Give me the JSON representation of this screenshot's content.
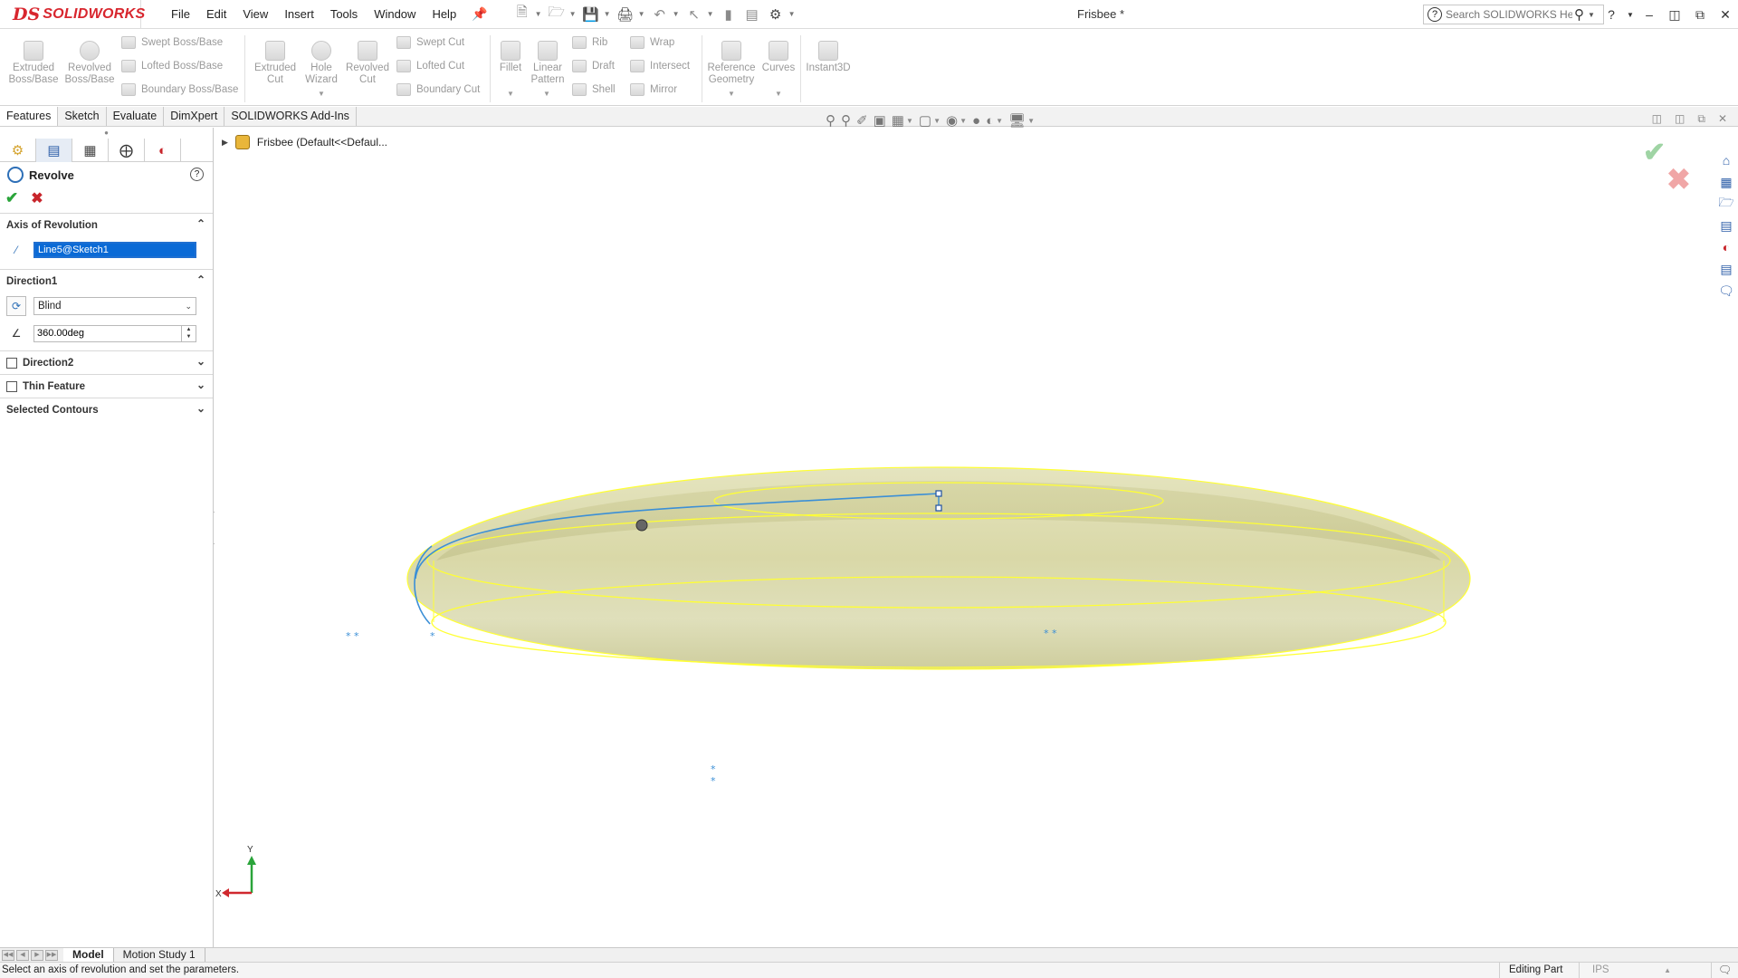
{
  "app": {
    "logo_prefix": "DS",
    "logo_text": "SOLIDWORKS",
    "document_title": "Frisbee *"
  },
  "menu": [
    "File",
    "Edit",
    "View",
    "Insert",
    "Tools",
    "Window",
    "Help"
  ],
  "search": {
    "placeholder": "Search SOLIDWORKS Help"
  },
  "command_manager": {
    "extruded_boss": "Extruded Boss/Base",
    "revolved_boss": "Revolved Boss/Base",
    "swept_boss": "Swept Boss/Base",
    "lofted_boss": "Lofted Boss/Base",
    "boundary_boss": "Boundary Boss/Base",
    "extruded_cut": "Extruded Cut",
    "hole_wizard": "Hole Wizard",
    "revolved_cut": "Revolved Cut",
    "swept_cut": "Swept Cut",
    "lofted_cut": "Lofted Cut",
    "boundary_cut": "Boundary Cut",
    "fillet": "Fillet",
    "linear_pattern": "Linear Pattern",
    "rib": "Rib",
    "draft": "Draft",
    "shell": "Shell",
    "wrap": "Wrap",
    "intersect": "Intersect",
    "mirror": "Mirror",
    "reference_geometry": "Reference Geometry",
    "curves": "Curves",
    "instant3d": "Instant3D"
  },
  "tabs": [
    "Features",
    "Sketch",
    "Evaluate",
    "DimXpert",
    "SOLIDWORKS Add-Ins"
  ],
  "feature_tree": {
    "root": "Frisbee  (Default<<Defaul..."
  },
  "property_manager": {
    "title": "Revolve",
    "help": "?",
    "axis_group": "Axis of Revolution",
    "axis_value": "Line5@Sketch1",
    "direction1_group": "Direction1",
    "direction1_type": "Blind",
    "angle_value": "360.00deg",
    "direction2_group": "Direction2",
    "thin_feature_group": "Thin Feature",
    "selected_contours_group": "Selected Contours"
  },
  "triad": {
    "x_label": "X",
    "y_label": "Y"
  },
  "bottom_tabs": [
    "Model",
    "Motion Study 1"
  ],
  "status": {
    "message": "Select an axis of revolution and set the parameters.",
    "mode": "Editing Part",
    "units": "IPS"
  },
  "colors": {
    "accent": "#1f6fd1",
    "brand_red": "#d8262e",
    "preview_fill": "#d9d8a6",
    "preview_edge": "#ffff33",
    "sketch_blue": "#3b8fd6"
  }
}
